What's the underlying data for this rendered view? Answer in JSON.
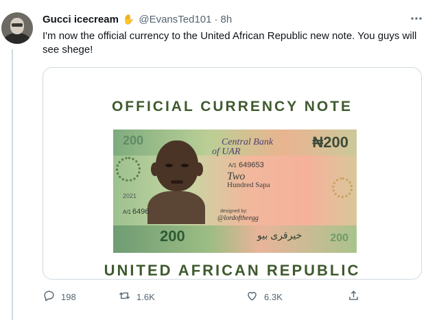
{
  "tweet": {
    "author_name": "Gucci icecream",
    "author_emoji": "✋",
    "handle": "@EvansTed101",
    "separator": "·",
    "time": "8h",
    "text": "I'm now the official currency to the United African Republic new note. You guys will see shege!",
    "more_icon": "more-horizontal-icon"
  },
  "card": {
    "top_title": "OFFICIAL CURRENCY NOTE",
    "bottom_title": "UNITED AFRICAN REPUBLIC",
    "banknote": {
      "bank_line1": "Central Bank",
      "bank_line2": "of UAR",
      "denomination": "₦200",
      "denomination_faded": "200",
      "serial_fraction": "A/1",
      "serial_number": "649653",
      "amount_line1": "Two",
      "amount_line2": "Hundred Sapa",
      "year": "2021",
      "serial_left": "6496",
      "designed_by": "designed by:",
      "signature": "@lordoftheegg",
      "bottom_denomination": "200",
      "arabic_text": "ﺧﯿﺮﻗﺮﯼ ﺑﯿﻮ",
      "bottom_right_denomination": "200"
    }
  },
  "actions": {
    "reply_count": "198",
    "retweet_count": "1.6K",
    "like_count": "6.3K"
  },
  "colors": {
    "title_green": "#3f5a2e",
    "meta_gray": "#536471",
    "border": "#cfd9de"
  }
}
